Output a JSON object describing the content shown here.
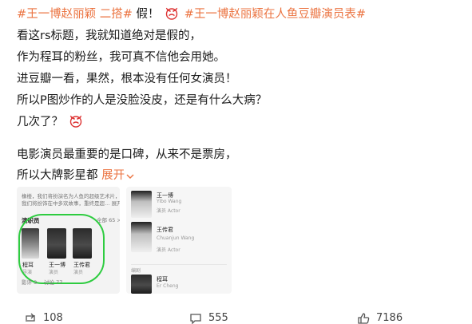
{
  "post": {
    "line1": {
      "tag1": "#王一博赵丽颖 二搭#",
      "exclaim": "假！",
      "tag2": "#王一博赵丽颖在人鱼豆瓣演员表#"
    },
    "line2": "看这rs标题，我就知道绝对是假的，",
    "line3": "作为程耳的粉丝，我可真不信他会用她。",
    "line4": "进豆瓣一看，果然，根本没有任何女演员！",
    "line5": "所以P图炒作的人是没脸没皮，还是有什么大病？",
    "line6": "几次了？",
    "line7": "电影演员最重要的是口碑，从来不是票房，",
    "line8": "所以大牌影星都",
    "expand_label": "展开",
    "emoji_name": "angry-emoji"
  },
  "image1": {
    "caption1": "橡楼，我们将扮演名为人鱼的超级艺术片，",
    "caption2": "我们将扮饰在中多欢故事，重终是超… 展开",
    "section": "演职员",
    "all": "全部 65 >",
    "cast": [
      {
        "name": "程耳",
        "role": "导演"
      },
      {
        "name": "王一博",
        "role": "演员"
      },
      {
        "name": "王传君",
        "role": "演员"
      }
    ],
    "footer1": "影评 3",
    "footer2": "讨论 77"
  },
  "image2": {
    "rows": [
      {
        "cn": "王一博",
        "en": "Yibo Wang",
        "role": "演员 Actor"
      },
      {
        "cn": "王传君",
        "en": "Chuanjun Wang",
        "role": "演员 Actor"
      }
    ],
    "label": "编剧",
    "third": {
      "cn": "程耳",
      "en": "Er Cheng"
    }
  },
  "actions": {
    "repost": "108",
    "comment": "555",
    "like": "7186"
  },
  "colors": {
    "accent": "#eb7340",
    "text": "#1a1a1a",
    "action_text": "#444444"
  }
}
